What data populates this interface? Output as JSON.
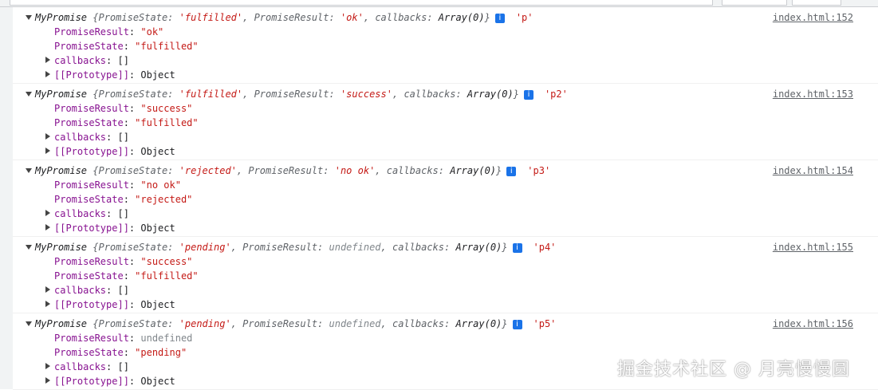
{
  "messages": [
    {
      "head": "MyPromise",
      "preview": [
        {
          "k": "PromiseState",
          "v": "'fulfilled'",
          "t": "str"
        },
        {
          "k": "PromiseResult",
          "v": "'ok'",
          "t": "str"
        },
        {
          "k": "callbacks",
          "v": "Array(0)",
          "t": "obj"
        }
      ],
      "tag": "'p'",
      "source": "index.html:152",
      "props": [
        {
          "k": "PromiseResult",
          "v": "\"ok\"",
          "t": "str",
          "expand": false
        },
        {
          "k": "PromiseState",
          "v": "\"fulfilled\"",
          "t": "str",
          "expand": false
        },
        {
          "k": "callbacks",
          "v": "[]",
          "t": "obj",
          "expand": true
        },
        {
          "k": "[[Prototype]]",
          "v": "Object",
          "t": "obj",
          "expand": true
        }
      ]
    },
    {
      "head": "MyPromise",
      "preview": [
        {
          "k": "PromiseState",
          "v": "'fulfilled'",
          "t": "str"
        },
        {
          "k": "PromiseResult",
          "v": "'success'",
          "t": "str"
        },
        {
          "k": "callbacks",
          "v": "Array(0)",
          "t": "obj"
        }
      ],
      "tag": "'p2'",
      "source": "index.html:153",
      "props": [
        {
          "k": "PromiseResult",
          "v": "\"success\"",
          "t": "str",
          "expand": false
        },
        {
          "k": "PromiseState",
          "v": "\"fulfilled\"",
          "t": "str",
          "expand": false
        },
        {
          "k": "callbacks",
          "v": "[]",
          "t": "obj",
          "expand": true
        },
        {
          "k": "[[Prototype]]",
          "v": "Object",
          "t": "obj",
          "expand": true
        }
      ]
    },
    {
      "head": "MyPromise",
      "preview": [
        {
          "k": "PromiseState",
          "v": "'rejected'",
          "t": "str"
        },
        {
          "k": "PromiseResult",
          "v": "'no ok'",
          "t": "str"
        },
        {
          "k": "callbacks",
          "v": "Array(0)",
          "t": "obj"
        }
      ],
      "tag": "'p3'",
      "source": "index.html:154",
      "props": [
        {
          "k": "PromiseResult",
          "v": "\"no ok\"",
          "t": "str",
          "expand": false
        },
        {
          "k": "PromiseState",
          "v": "\"rejected\"",
          "t": "str",
          "expand": false
        },
        {
          "k": "callbacks",
          "v": "[]",
          "t": "obj",
          "expand": true
        },
        {
          "k": "[[Prototype]]",
          "v": "Object",
          "t": "obj",
          "expand": true
        }
      ]
    },
    {
      "head": "MyPromise",
      "preview": [
        {
          "k": "PromiseState",
          "v": "'pending'",
          "t": "str"
        },
        {
          "k": "PromiseResult",
          "v": "undefined",
          "t": "und"
        },
        {
          "k": "callbacks",
          "v": "Array(0)",
          "t": "obj"
        }
      ],
      "tag": "'p4'",
      "source": "index.html:155",
      "props": [
        {
          "k": "PromiseResult",
          "v": "\"success\"",
          "t": "str",
          "expand": false
        },
        {
          "k": "PromiseState",
          "v": "\"fulfilled\"",
          "t": "str",
          "expand": false
        },
        {
          "k": "callbacks",
          "v": "[]",
          "t": "obj",
          "expand": true
        },
        {
          "k": "[[Prototype]]",
          "v": "Object",
          "t": "obj",
          "expand": true
        }
      ]
    },
    {
      "head": "MyPromise",
      "preview": [
        {
          "k": "PromiseState",
          "v": "'pending'",
          "t": "str"
        },
        {
          "k": "PromiseResult",
          "v": "undefined",
          "t": "und"
        },
        {
          "k": "callbacks",
          "v": "Array(0)",
          "t": "obj"
        }
      ],
      "tag": "'p5'",
      "source": "index.html:156",
      "props": [
        {
          "k": "PromiseResult",
          "v": "undefined",
          "t": "und",
          "expand": false
        },
        {
          "k": "PromiseState",
          "v": "\"pending\"",
          "t": "str",
          "expand": false
        },
        {
          "k": "callbacks",
          "v": "[]",
          "t": "obj",
          "expand": true
        },
        {
          "k": "[[Prototype]]",
          "v": "Object",
          "t": "obj",
          "expand": true
        }
      ]
    }
  ],
  "info_glyph": "i",
  "icons": {
    "info": "info-icon",
    "expand": "triangle-icon"
  },
  "watermark": "掘金技术社区 @ 月亮慢慢圆",
  "colors": {
    "string": "#c41a16",
    "key": "#881391",
    "undefined": "#80868b",
    "info": "#1a73e8"
  }
}
